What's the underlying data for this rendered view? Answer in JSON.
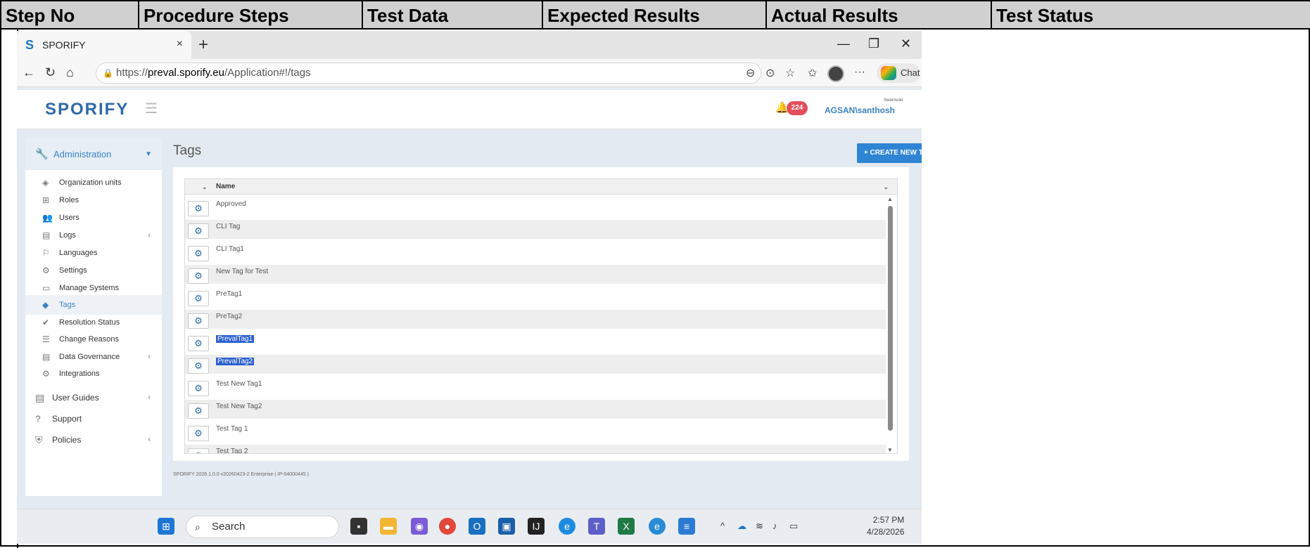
{
  "doc_table": {
    "headers": [
      "Step No",
      "Procedure Steps",
      "Test Data",
      "Expected Results",
      "Actual Results",
      "Test Status"
    ]
  },
  "browser": {
    "tab_title": "SPORIFY",
    "tab_close": "×",
    "new_tab": "+",
    "url_host": "preval.sporify.eu",
    "url_prefix": "https://",
    "url_path": "/Application#!/tags",
    "chat_label": "Chat"
  },
  "app": {
    "logo_text": "SPORIFY",
    "notification_count": "224",
    "username": "AGSAN\\santhosh",
    "brand_mark_text": "Swarovski",
    "page_title": "Tags",
    "create_button_label": "+ CREATE NEW TAG",
    "grid_header": "Name",
    "footer": "SPORIFY 2026.1.0.0 v20260423-2 Enterprise ( IP-04000445 )"
  },
  "sidebar": {
    "admin_label": "Administration",
    "items": [
      {
        "label": "Organization units",
        "icon": "layers-icon"
      },
      {
        "label": "Roles",
        "icon": "roles-icon"
      },
      {
        "label": "Users",
        "icon": "users-icon"
      },
      {
        "label": "Logs",
        "icon": "book-icon"
      },
      {
        "label": "Languages",
        "icon": "flag-icon"
      },
      {
        "label": "Settings",
        "icon": "gear-icon"
      },
      {
        "label": "Manage Systems",
        "icon": "laptop-icon"
      },
      {
        "label": "Tags",
        "icon": "tags-icon"
      },
      {
        "label": "Resolution Status",
        "icon": "check-icon"
      },
      {
        "label": "Change Reasons",
        "icon": "list-icon"
      },
      {
        "label": "Data Governance",
        "icon": "book-icon"
      },
      {
        "label": "Integrations",
        "icon": "cogs-icon"
      }
    ],
    "bottom_items": [
      {
        "label": "User Guides",
        "icon": "book-icon"
      },
      {
        "label": "Support",
        "icon": "question-icon"
      },
      {
        "label": "Policies",
        "icon": "shield-icon"
      }
    ]
  },
  "tags": [
    {
      "name": "Approved"
    },
    {
      "name": "CLI Tag"
    },
    {
      "name": "CLI Tag1"
    },
    {
      "name": "New Tag for Test"
    },
    {
      "name": "PreTag1"
    },
    {
      "name": "PreTag2"
    },
    {
      "name": "PrevalTag1"
    },
    {
      "name": "PrevalTag2"
    },
    {
      "name": "Test New Tag1"
    },
    {
      "name": "Test New Tag2"
    },
    {
      "name": "Test Tag 1"
    },
    {
      "name": "Test Tag 2"
    }
  ],
  "taskbar": {
    "search_label": "Search",
    "time": "2:57 PM",
    "date": "4/28/2026"
  }
}
